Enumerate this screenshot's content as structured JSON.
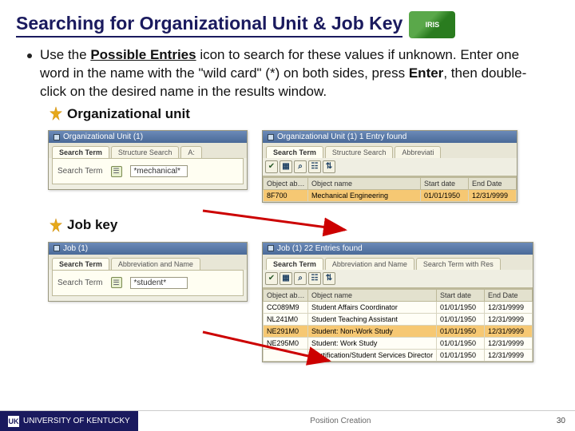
{
  "title": "Searching for Organizational Unit & Job Key",
  "iris": "IRIS",
  "bullet": {
    "pre": "Use the ",
    "pe": "Possible Entries",
    "mid": " icon to search for these values if unknown.  Enter one word in the name with the \"wild card\" (*) on both sides, press ",
    "enter": "Enter",
    "post": ", then double-click on the desired name in the results window."
  },
  "org": {
    "heading": "Organizational unit",
    "left": {
      "winTitle": "Organizational Unit (1)",
      "tabs": [
        "Search Term",
        "Structure Search"
      ],
      "tabExtra": "A:",
      "label": "Search Term",
      "value": "*mechanical*"
    },
    "right": {
      "winTitle": "Organizational Unit (1)   1 Entry found",
      "tabs": [
        "Search Term",
        "Structure Search",
        "Abbreviati"
      ],
      "cols": [
        "Object ab…",
        "Object name",
        "Start date",
        "End Date"
      ],
      "row": [
        "8F700",
        "Mechanical Engineering",
        "01/01/1950",
        "12/31/9999"
      ]
    }
  },
  "job": {
    "heading": "Job key",
    "left": {
      "winTitle": "Job (1)",
      "tabs": [
        "Search Term",
        "Abbreviation and Name"
      ],
      "label": "Search Term",
      "value": "*student*"
    },
    "right": {
      "winTitle": "Job (1)   22 Entries found",
      "tabs": [
        "Search Term",
        "Abbreviation and Name",
        "Search Term with Res"
      ],
      "cols": [
        "Object ab…",
        "Object name",
        "Start date",
        "End Date"
      ],
      "rows": [
        [
          "CC089M9",
          "Student Affairs Coordinator",
          "01/01/1950",
          "12/31/9999"
        ],
        [
          "NL241M0",
          "Student Teaching Assistant",
          "01/01/1950",
          "12/31/9999"
        ],
        [
          "NE291M0",
          "Student: Non-Work Study",
          "01/01/1950",
          "12/31/9999"
        ],
        [
          "NE295M0",
          "Student: Work Study",
          "01/01/1950",
          "12/31/9999"
        ],
        [
          "",
          "Certification/Student Services Director",
          "01/01/1950",
          "12/31/9999"
        ]
      ],
      "hlIndex": 2
    }
  },
  "footer": {
    "uk": "UNIVERSITY OF KENTUCKY",
    "center": "Position Creation",
    "page": "30"
  }
}
